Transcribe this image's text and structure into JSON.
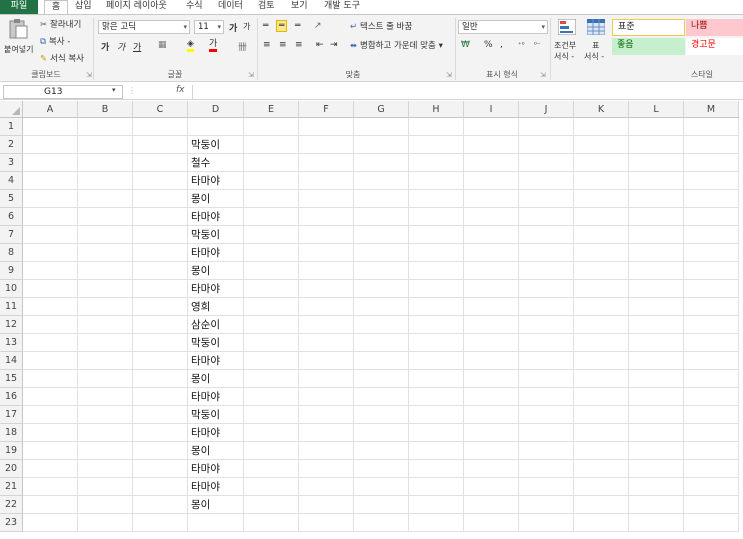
{
  "menu": {
    "tabs": [
      "파일",
      "홈",
      "삽입",
      "페이지 레이아웃",
      "수식",
      "데이터",
      "검토",
      "보기",
      "개발 도구"
    ]
  },
  "ribbon": {
    "clipboard": {
      "paste": "붙여넣기",
      "cut": "잘라내기",
      "copy": "복사 -",
      "format_painter": "서식 복사",
      "label": "클립보드"
    },
    "font": {
      "name": "맑은 고딕",
      "size": "11",
      "bold": "가",
      "italic": "가",
      "underline": "가",
      "label": "글꼴"
    },
    "alignment": {
      "wrap_text": "텍스트 줄 바꿈",
      "merge_center": "병합하고 가운데 맞춤",
      "label": "맞춤"
    },
    "number": {
      "format": "일반",
      "percent": "%",
      "comma": ",",
      "label": "표시 형식"
    },
    "styles": {
      "conditional_line1": "조건부",
      "conditional_line2": "서식 -",
      "table_line1": "표",
      "table_line2": "서식 -",
      "normal": "표준",
      "bad": "나쁨",
      "good": "좋음",
      "warning": "경고문",
      "label": "스타일"
    },
    "colors": {
      "normal_border": "#f2c94c",
      "bad_bg": "#ffc7ce",
      "bad_text": "#9c0006",
      "good_bg": "#c6efce",
      "good_text": "#006100",
      "warning_text": "#ff0000"
    }
  },
  "formula_bar": {
    "name_box": "G13",
    "fx": "fx",
    "content": ""
  },
  "sheet": {
    "columns": [
      "A",
      "B",
      "C",
      "D",
      "E",
      "F",
      "G",
      "H",
      "I",
      "J",
      "K",
      "L",
      "M"
    ],
    "rows": [
      "1",
      "2",
      "3",
      "4",
      "5",
      "6",
      "7",
      "8",
      "9",
      "10",
      "11",
      "12",
      "13",
      "14",
      "15",
      "16",
      "17",
      "18",
      "19",
      "20",
      "21",
      "22",
      "23"
    ],
    "column_d_values": [
      "",
      "막둥이",
      "철수",
      "타마야",
      "몽이",
      "타마야",
      "막둥이",
      "타마야",
      "몽이",
      "타마야",
      "영희",
      "삼순이",
      "막둥이",
      "타마야",
      "몽이",
      "타마야",
      "막둥이",
      "타마야",
      "몽이",
      "타마야",
      "타마야",
      "몽이",
      ""
    ]
  }
}
